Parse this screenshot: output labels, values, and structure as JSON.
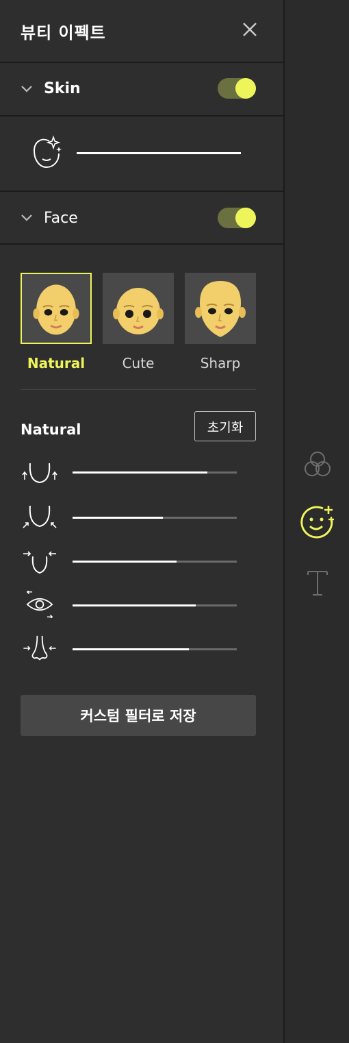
{
  "header": {
    "title": "뷰티 이펙트",
    "close_icon": "close-icon"
  },
  "skin": {
    "label": "Skin",
    "enabled": true,
    "slider_value": 1.0,
    "icon": "skin-sparkle-icon"
  },
  "face": {
    "label": "Face",
    "enabled": true,
    "presets": [
      {
        "label": "Natural",
        "selected": true
      },
      {
        "label": "Cute",
        "selected": false
      },
      {
        "label": "Sharp",
        "selected": false
      }
    ],
    "active_preset": "Natural",
    "reset_label": "초기화",
    "adjustments": [
      {
        "icon": "jaw-up-icon",
        "value": 0.82
      },
      {
        "icon": "chin-narrow-icon",
        "value": 0.55
      },
      {
        "icon": "face-slim-icon",
        "value": 0.63
      },
      {
        "icon": "eye-size-icon",
        "value": 0.75
      },
      {
        "icon": "nose-slim-icon",
        "value": 0.71
      }
    ],
    "save_label": "커스텀 필터로 저장"
  },
  "rail": {
    "items": [
      {
        "icon": "filter-circles-icon",
        "active": false
      },
      {
        "icon": "beauty-face-icon",
        "active": true
      },
      {
        "icon": "text-icon",
        "active": false
      }
    ]
  },
  "colors": {
    "accent": "#eef55a",
    "panel": "#2e2e2e",
    "divider": "#1b1b1b"
  }
}
